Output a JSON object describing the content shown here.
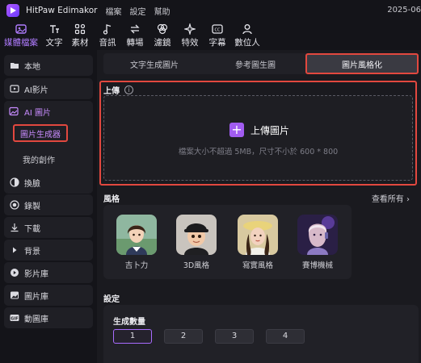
{
  "titlebar": {
    "app_name": "HitPaw Edimakor",
    "menu": [
      "檔案",
      "設定",
      "幫助"
    ],
    "date": "2025-06"
  },
  "toolbar": {
    "items": [
      {
        "label": "媒體檔案",
        "icon": "media-icon",
        "active": true
      },
      {
        "label": "文字",
        "icon": "text-icon"
      },
      {
        "label": "素材",
        "icon": "assets-icon"
      },
      {
        "label": "音訊",
        "icon": "audio-icon"
      },
      {
        "label": "轉場",
        "icon": "transition-icon"
      },
      {
        "label": "濾鏡",
        "icon": "filter-icon"
      },
      {
        "label": "特效",
        "icon": "effects-icon"
      },
      {
        "label": "字幕",
        "icon": "subtitle-icon"
      },
      {
        "label": "數位人",
        "icon": "digital-human-icon"
      }
    ],
    "accent": "#b07cff"
  },
  "sidebar": {
    "items": [
      {
        "label": "本地",
        "icon": "folder-icon"
      },
      {
        "label": "AI影片",
        "icon": "ai-video-icon"
      },
      {
        "label": "AI 圖片",
        "icon": "ai-image-icon"
      },
      {
        "label": "換臉",
        "icon": "face-swap-icon"
      },
      {
        "label": "錄製",
        "icon": "record-icon"
      },
      {
        "label": "下載",
        "icon": "download-icon"
      },
      {
        "label": "背景",
        "icon": "background-icon"
      },
      {
        "label": "影片庫",
        "icon": "video-library-icon"
      },
      {
        "label": "圖片庫",
        "icon": "image-library-icon"
      },
      {
        "label": "動圖庫",
        "icon": "gif-library-icon"
      }
    ],
    "ai_image_sub": {
      "active": "圖片生成器",
      "other": "我的創作"
    }
  },
  "main": {
    "tabs": [
      "文字生成圖片",
      "參考圖生圖",
      "圖片風格化"
    ],
    "active_tab": 2,
    "upload": {
      "title": "上傳",
      "button": "上傳圖片",
      "hint": "檔案大小不超過 5MB，尺寸不小於 600 * 800"
    },
    "style": {
      "title": "風格",
      "see_all": "查看所有 ›",
      "options": [
        "吉卜力",
        "3D風格",
        "寫實風格",
        "賽博機械"
      ]
    },
    "settings": {
      "title": "設定",
      "count_label": "生成數量",
      "counts": [
        "1",
        "2",
        "3",
        "4"
      ],
      "selected": "1"
    }
  },
  "colors": {
    "highlight_border": "#e2483f",
    "purple": "#a15cf0"
  }
}
